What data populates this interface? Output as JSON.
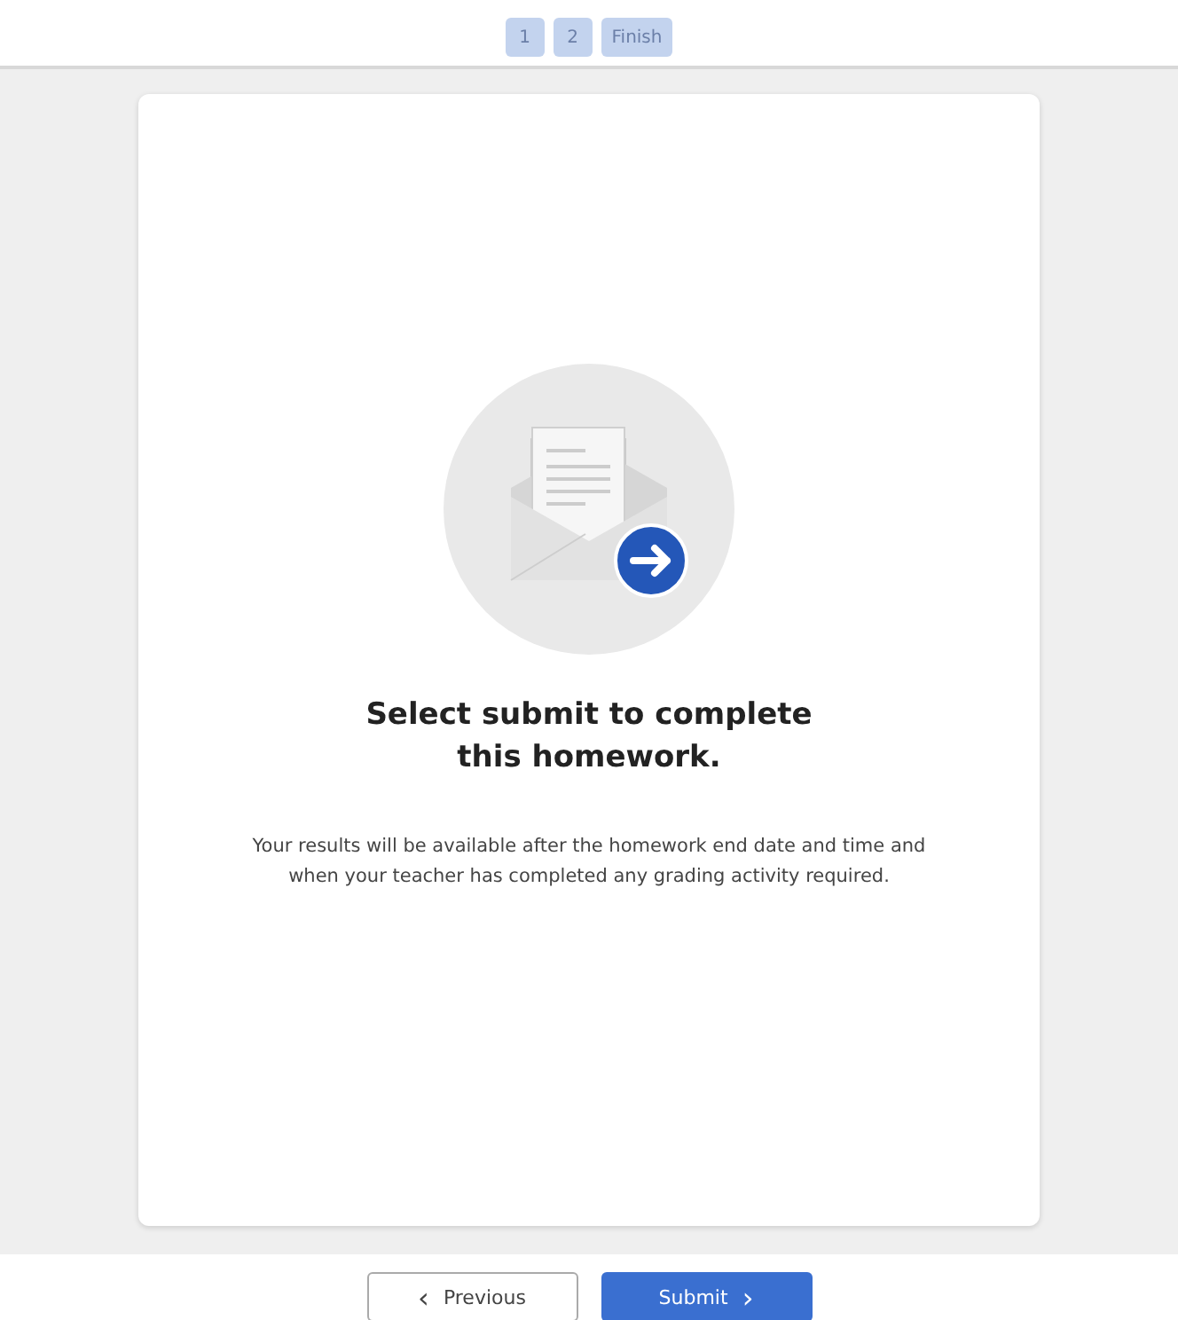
{
  "steps": [
    {
      "label": "1"
    },
    {
      "label": "2"
    },
    {
      "label": "Finish"
    }
  ],
  "card": {
    "heading": "Select submit to complete this homework.",
    "message": "Your results will be available after the homework end date and time and when your teacher has completed any grading activity required."
  },
  "footer": {
    "previous": {
      "icon": "‹",
      "label": "Previous"
    },
    "submit": {
      "label": "Submit",
      "icon": "›"
    }
  }
}
